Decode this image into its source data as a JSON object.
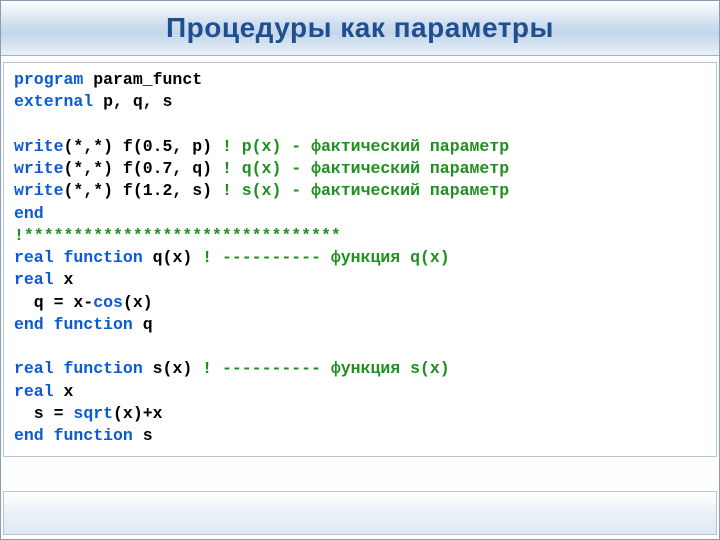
{
  "title": "Процедуры как параметры",
  "code": {
    "l1": {
      "a": "program",
      "b": " param_funct"
    },
    "l2": {
      "a": "external",
      "b": " p, q, s"
    },
    "l3": "",
    "l4": {
      "a": "write",
      "b": "(*,*) f(0.5, p) ",
      "c": "! p(x) - фактический параметр"
    },
    "l5": {
      "a": "write",
      "b": "(*,*) f(0.7, q) ",
      "c": "! q(x) - фактический параметр"
    },
    "l6": {
      "a": "write",
      "b": "(*,*) f(1.2, s) ",
      "c": "! s(x) - фактический параметр"
    },
    "l7": {
      "a": "end"
    },
    "l8": {
      "c": "!********************************"
    },
    "l9": {
      "a": "real function",
      "b": " q(x) ",
      "c": "! ---------- функция q(x)"
    },
    "l10": {
      "a": "real",
      "b": " x"
    },
    "l11": {
      "b": "  q = x-",
      "d": "cos",
      "e": "(x)"
    },
    "l12": {
      "a": "end function",
      "b": " q"
    },
    "l13": "",
    "l14": {
      "a": "real function",
      "b": " s(x) ",
      "c": "! ---------- функция s(x)"
    },
    "l15": {
      "a": "real",
      "b": " x"
    },
    "l16": {
      "b": "  s = ",
      "d": "sqrt",
      "e": "(x)+x"
    },
    "l17": {
      "a": "end function",
      "b": " s"
    }
  }
}
